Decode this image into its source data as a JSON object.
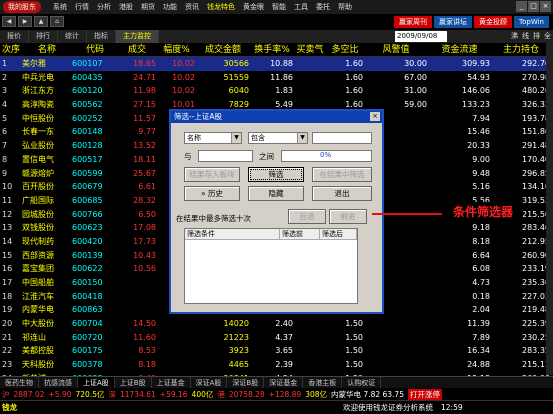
{
  "menubar": {
    "logo": "我的股东",
    "items": [
      "系统",
      "行情",
      "分析",
      "港股",
      "期货",
      "功能",
      "资讯",
      "钱龙特色",
      "黄金眼",
      "智能",
      "工具",
      "委托",
      "帮助"
    ],
    "highlight_item": "钱龙特色",
    "promo": "赢家周刊"
  },
  "bar2": {
    "promo_btn1": "赢家讲坛",
    "promo_btn2": "黄金投顾",
    "promo_btn3": "TopWin"
  },
  "tabs": [
    "报价",
    "排行",
    "综计",
    "指标",
    "主力监控"
  ],
  "active_tab": "主力监控",
  "date": "2009/09/08",
  "right_links": [
    "沸",
    "线",
    "排",
    "全"
  ],
  "table": {
    "headers": [
      "次序",
      "名称",
      "代码",
      "成交",
      "幅度%",
      "成交金额",
      "换手率%",
      "买卖气",
      "多空比",
      "风警值",
      "资金流速",
      "主力持仓"
    ],
    "rows": [
      [
        "1",
        "美尔雅",
        "600107",
        "18.65",
        "10.02",
        "30566",
        "10.88",
        "",
        "1.60",
        "30.00",
        "309.93",
        "292.76"
      ],
      [
        "2",
        "中兵光电",
        "600435",
        "24.71",
        "10.02",
        "51559",
        "11.86",
        "",
        "1.60",
        "67.00",
        "54.93",
        "270.98"
      ],
      [
        "3",
        "浙江东方",
        "600120",
        "11.98",
        "10.02",
        "6040",
        "1.83",
        "",
        "1.60",
        "31.00",
        "146.06",
        "480.26"
      ],
      [
        "4",
        "高淳陶瓷",
        "600562",
        "27.15",
        "10.01",
        "7829",
        "5.49",
        "",
        "1.60",
        "59.00",
        "133.23",
        "326.33"
      ],
      [
        "5",
        "中恒股份",
        "600252",
        "11.57",
        "",
        "",
        "",
        "",
        "",
        "",
        "7.94",
        "193.78"
      ],
      [
        "6",
        "长春一东",
        "600148",
        "9.77",
        "",
        "",
        "",
        "",
        "",
        "",
        "15.46",
        "151.86"
      ],
      [
        "7",
        "弘业股份",
        "600128",
        "13.52",
        "",
        "",
        "",
        "",
        "",
        "",
        "20.33",
        "291.48"
      ],
      [
        "8",
        "置信电气",
        "600517",
        "18.11",
        "",
        "",
        "",
        "",
        "",
        "",
        "9.00",
        "170.40"
      ],
      [
        "9",
        "赣源熔炉",
        "600599",
        "25.67",
        "",
        "",
        "",
        "",
        "",
        "",
        "9.48",
        "296.85"
      ],
      [
        "10",
        "百开股份",
        "600679",
        "6.61",
        "",
        "",
        "",
        "",
        "",
        "",
        "5.16",
        "134.16"
      ],
      [
        "11",
        "广船国际",
        "600685",
        "28.32",
        "",
        "",
        "",
        "",
        "",
        "",
        "5.56",
        "319.53"
      ],
      [
        "12",
        "园城股份",
        "600766",
        "6.50",
        "",
        "",
        "",
        "",
        "",
        "",
        "6.34",
        "215.50"
      ],
      [
        "13",
        "双钱股份",
        "600623",
        "17.08",
        "",
        "",
        "",
        "",
        "",
        "",
        "9.18",
        "283.46"
      ],
      [
        "14",
        "现代制药",
        "600420",
        "17.73",
        "",
        "",
        "",
        "",
        "",
        "",
        "8.18",
        "212.95"
      ],
      [
        "15",
        "西部资源",
        "600139",
        "10.43",
        "",
        "",
        "",
        "",
        "",
        "",
        "6.64",
        "260.90"
      ],
      [
        "16",
        "嘉宝集团",
        "600622",
        "10.56",
        "",
        "",
        "",
        "",
        "",
        "",
        "6.08",
        "233.19"
      ],
      [
        "17",
        "中国船舶",
        "600150",
        "",
        "",
        "",
        "",
        "",
        "",
        "",
        "4.73",
        "235.36"
      ],
      [
        "18",
        "江淮汽车",
        "600418",
        "",
        "",
        "",
        "",
        "",
        "",
        "",
        "0.18",
        "227.03"
      ],
      [
        "19",
        "内蒙华电",
        "600863",
        "",
        "",
        "",
        "",
        "",
        "",
        "",
        "2.04",
        "219.48"
      ],
      [
        "20",
        "中大股份",
        "600704",
        "14.50",
        "",
        "14020",
        "2.40",
        "",
        "1.50",
        "",
        "11.39",
        "225.39"
      ],
      [
        "21",
        "祁连山",
        "600720",
        "11.60",
        "",
        "21223",
        "4.37",
        "",
        "1.50",
        "",
        "7.89",
        "230.25"
      ],
      [
        "22",
        "美都控股",
        "600175",
        "8.53",
        "",
        "3923",
        "3.65",
        "",
        "1.50",
        "",
        "16.34",
        "283.35"
      ],
      [
        "23",
        "天科股份",
        "600378",
        "8.18",
        "",
        "4465",
        "2.39",
        "",
        "1.50",
        "",
        "24.88",
        "215.11"
      ],
      [
        "24",
        "新黄浦",
        "600638",
        "9.49",
        "",
        "20841",
        "4.24",
        "",
        "1.50",
        "",
        "15.18",
        "260.00"
      ]
    ],
    "selected_row": 0
  },
  "dialog": {
    "title": "筛选--上证A股",
    "field_dropdown": "名称",
    "op_dropdown": "包含",
    "label_and": "与",
    "label_between": "之间",
    "range_value": "0%",
    "btn_add_plate": "结果存入板块",
    "btn_filter": "筛选",
    "btn_filter_in_result": "在结果中筛选",
    "btn_history": "历史",
    "btn_hide": "隐藏",
    "btn_exit": "退出",
    "note": "在结果中最多筛选十次",
    "btn_back": "后退",
    "btn_forward": "前进",
    "list_headers": [
      "筛选条件",
      "筛选前",
      "筛选后"
    ]
  },
  "annotation": "条件筛选器",
  "bottom_tabs": [
    "医药生物",
    "抗感流感",
    "上证A股",
    "上证B股",
    "上证基金",
    "深证A股",
    "深证B股",
    "深证基金",
    "香港主板",
    "认购权证"
  ],
  "bottom_active": "上证A股",
  "index_bar": {
    "sh_label": "沪",
    "sh_value": "2887.02",
    "sh_change": "+5.90",
    "sh_amount": "720.5亿",
    "sz_label": "深",
    "sz_value": "11734.61",
    "sz_change": "+59.16",
    "sz_amount": "400亿",
    "hk_label": "港",
    "hk_value": "20758.28",
    "hk_change": "+128.89",
    "hk_amount": "308亿",
    "ticker": "内蒙华电 7.82 63.75",
    "ticker2": "打开涨停"
  },
  "status": {
    "brand": "钱龙",
    "left_text": "钱龙",
    "message": "欢迎使用钱龙证券分析系统",
    "time": "12:59"
  }
}
